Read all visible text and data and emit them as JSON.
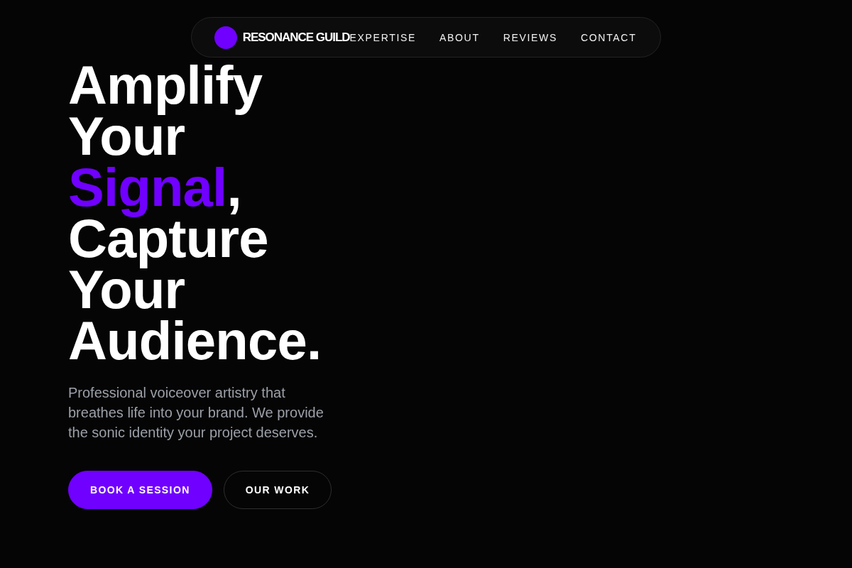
{
  "nav": {
    "brand": "RESONANCE GUILD",
    "links": [
      "EXPERTISE",
      "ABOUT",
      "REVIEWS",
      "CONTACT"
    ]
  },
  "hero": {
    "headline": [
      {
        "text": "Amplify Your ",
        "accent": false
      },
      {
        "text": "Signal",
        "accent": true
      },
      {
        "text": ", Capture Your Audience.",
        "accent": false
      }
    ],
    "description": "Professional voiceover artistry that breathes life into your brand. We provide the sonic identity your project deserves.",
    "buttons": [
      {
        "label": "BOOK A SESSION",
        "kind": "primary"
      },
      {
        "label": "OUR WORK",
        "kind": "outline"
      }
    ]
  }
}
